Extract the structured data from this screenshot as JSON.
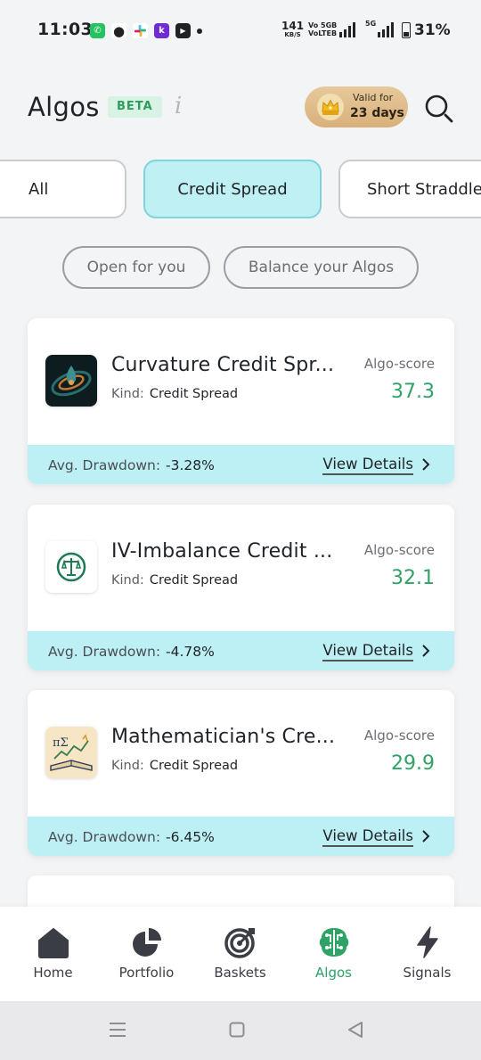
{
  "status_bar": {
    "time": "11:03",
    "net_speed_top": "141",
    "net_speed_bottom": "KB/S",
    "volte_top": "Vo 5GB",
    "volte_bottom": "VoLTEB",
    "five_g": "5G",
    "battery": "31%"
  },
  "header": {
    "title": "Algos",
    "beta_badge": "BETA",
    "info_icon": "i",
    "subscription": {
      "top": "Valid for",
      "bottom": "23 days"
    }
  },
  "tabs": [
    {
      "label": "All",
      "active": false
    },
    {
      "label": "Credit Spread",
      "active": true
    },
    {
      "label": "Short Straddle",
      "active": false
    }
  ],
  "chips": [
    {
      "label": "Open for you"
    },
    {
      "label": "Balance your Algos"
    }
  ],
  "cards": [
    {
      "name": "Curvature Credit Spr...",
      "kind_label": "Kind:",
      "kind": "Credit Spread",
      "score_label": "Algo-score",
      "score": "37.3",
      "drawdown_label": "Avg. Drawdown:",
      "drawdown": "-3.28%",
      "action": "View Details",
      "logo": "dark-swirl-logo"
    },
    {
      "name": "IV-Imbalance Credit ...",
      "kind_label": "Kind:",
      "kind": "Credit Spread",
      "score_label": "Algo-score",
      "score": "32.1",
      "drawdown_label": "Avg. Drawdown:",
      "drawdown": "-4.78%",
      "action": "View Details",
      "logo": "balance-scale-logo"
    },
    {
      "name": "Mathematician's Cre...",
      "kind_label": "Kind:",
      "kind": "Credit Spread",
      "score_label": "Algo-score",
      "score": "29.9",
      "drawdown_label": "Avg. Drawdown:",
      "drawdown": "-6.45%",
      "action": "View Details",
      "logo": "math-book-logo",
      "logo_text": "πΣ"
    }
  ],
  "bottom_nav": [
    {
      "label": "Home",
      "icon": "home-icon",
      "active": false
    },
    {
      "label": "Portfolio",
      "icon": "pie-chart-icon",
      "active": false
    },
    {
      "label": "Baskets",
      "icon": "target-icon",
      "active": false
    },
    {
      "label": "Algos",
      "icon": "brain-circuit-icon",
      "active": true
    },
    {
      "label": "Signals",
      "icon": "lightning-icon",
      "active": false
    }
  ],
  "colors": {
    "accent_green": "#2fa266",
    "tab_active_bg": "#bff0f3",
    "card_footer_bg": "#bdf0f4",
    "beta_bg": "#d8f3e3"
  }
}
